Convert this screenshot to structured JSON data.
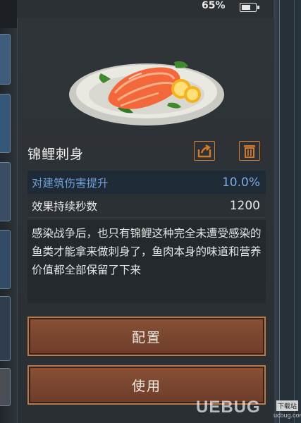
{
  "status_bar": {
    "battery_percent": "65%"
  },
  "item": {
    "name": "锦鲤刺身",
    "stats": [
      {
        "label": "对建筑伤害提升",
        "value": "10.0%"
      },
      {
        "label": "效果持续秒数",
        "value": "1200"
      }
    ],
    "description": "感染战争后，也只有锦鲤这种完全未遭受感染的鱼类才能拿来做刺身了，鱼肉本身的味道和营养价值都全部保留了下来"
  },
  "actions": {
    "configure": "配置",
    "use": "使用"
  },
  "icons": {
    "share": "share-icon",
    "delete": "trash-icon",
    "battery": "battery-icon"
  },
  "colors": {
    "accent_orange": "#d27a2a",
    "stat_highlight": "#6fa0d8",
    "button_brown": "#7a4630"
  },
  "watermark": {
    "brand": "UEBUG",
    "tag": "下载站",
    "site": "ucbug.com"
  }
}
